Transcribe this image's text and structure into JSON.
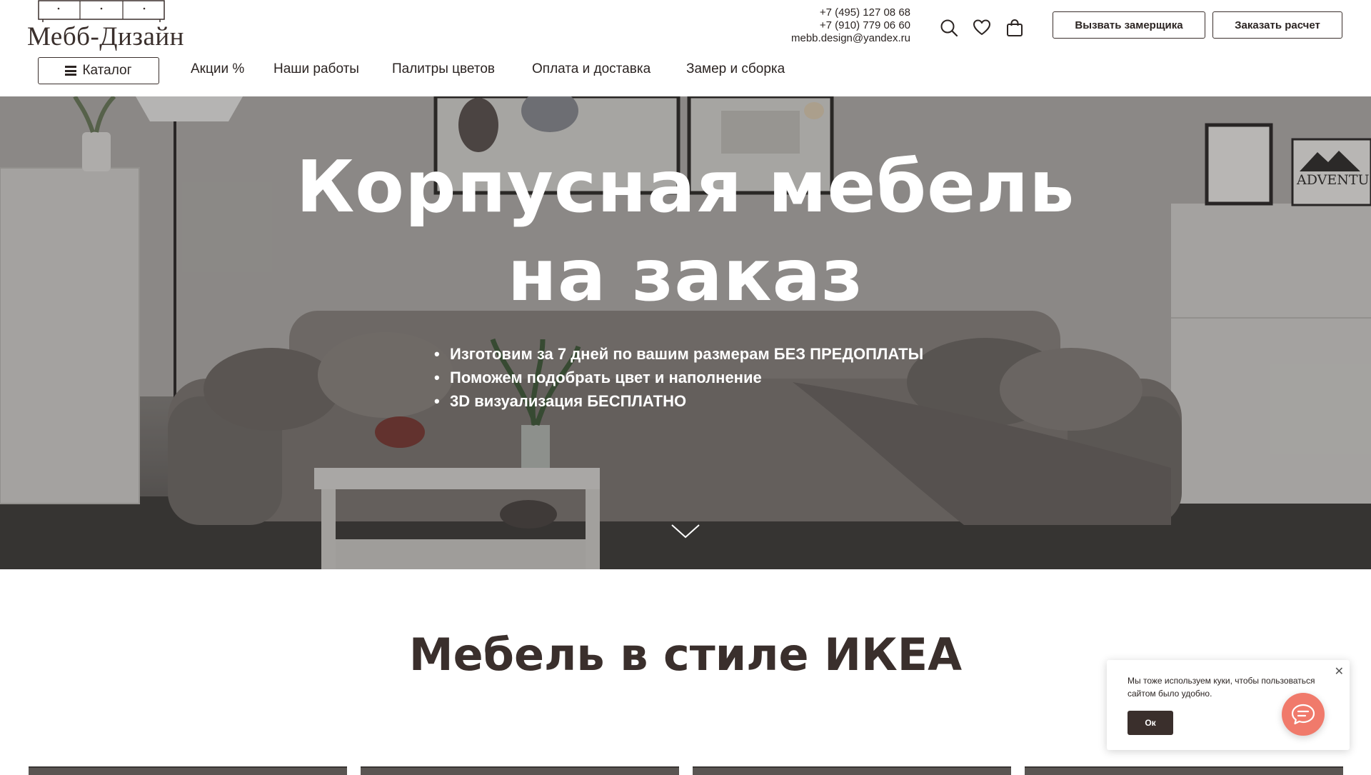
{
  "brand": {
    "logo_text": "Мебб-Дизайн"
  },
  "contacts": {
    "phone1": "+7 (495) 127 08 68",
    "phone2": "+7 (910) 779 06 60",
    "email": "mebb.design@yandex.ru"
  },
  "header": {
    "icons": [
      "search-icon",
      "heart-icon",
      "shopping-bag-icon"
    ],
    "measure_button": "Вызвать замерщика",
    "calc_button": "Заказать расчет",
    "catalog_button": "Каталог"
  },
  "nav": {
    "items": [
      {
        "label": "Акции %"
      },
      {
        "label": "Наши работы"
      },
      {
        "label": "Палитры цветов"
      },
      {
        "label": "Оплата и доставка"
      },
      {
        "label": "Замер и сборка"
      }
    ]
  },
  "hero": {
    "title_line1": "Корпусная мебель",
    "title_line2": "на заказ",
    "bullets": [
      "Изготовим за 7 дней по вашим размерам БЕЗ ПРЕДОПЛАТЫ",
      "Поможем подобрать цвет и наполнение",
      "3D визуализация БЕСПЛАТНО"
    ],
    "poster_text": "ADVENTURE"
  },
  "section": {
    "title": "Мебель в стиле ИКЕА"
  },
  "cookie": {
    "text": "Мы тоже используем куки, чтобы пользоваться сайтом было удобно.",
    "ok_button": "Ок"
  },
  "colors": {
    "brand_dark": "#3a2f2c",
    "chat_accent": "#f07a6b",
    "hero_text": "#ffffff"
  }
}
